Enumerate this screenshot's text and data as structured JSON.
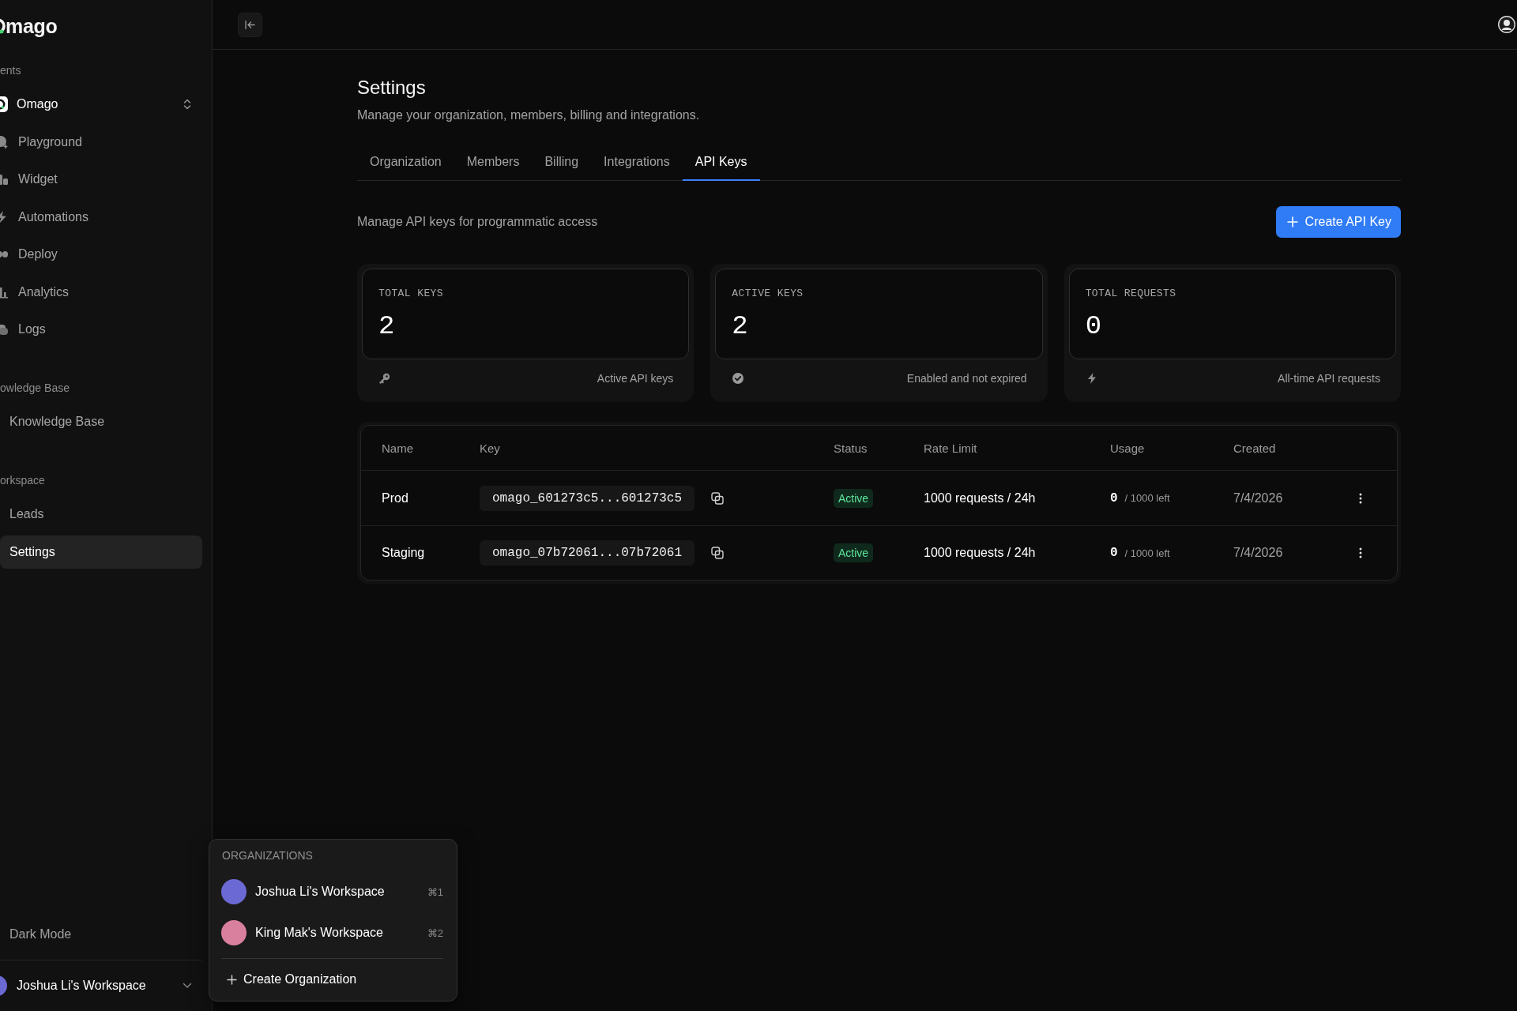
{
  "sidebar": {
    "logo": "mago",
    "groups": [
      {
        "label": "ents",
        "items": [
          {
            "kind": "selector",
            "label": "Omago",
            "selected": false
          },
          {
            "kind": "nav",
            "label": "Playground",
            "selected": false
          },
          {
            "kind": "nav",
            "label": "Widget",
            "selected": false
          },
          {
            "kind": "nav",
            "label": "Automations",
            "selected": false
          },
          {
            "kind": "nav",
            "label": "Deploy",
            "selected": false
          },
          {
            "kind": "nav",
            "label": "Analytics",
            "selected": false
          },
          {
            "kind": "nav",
            "label": "Logs",
            "selected": false
          }
        ]
      },
      {
        "label": "owledge Base",
        "items": [
          {
            "kind": "plain",
            "label": "Knowledge Base",
            "selected": false
          }
        ]
      },
      {
        "label": "orkspace",
        "items": [
          {
            "kind": "plain",
            "label": "Leads",
            "selected": false
          },
          {
            "kind": "plain",
            "label": "Settings",
            "selected": true
          }
        ]
      }
    ],
    "dark_mode": "Dark Mode",
    "workspace": "Joshua Li's Workspace"
  },
  "page": {
    "title": "Settings",
    "subtitle": "Manage your organization, members, billing and integrations.",
    "tabs": [
      {
        "label": "Organization",
        "selected": false
      },
      {
        "label": "Members",
        "selected": false
      },
      {
        "label": "Billing",
        "selected": false
      },
      {
        "label": "Integrations",
        "selected": false
      },
      {
        "label": "API Keys",
        "selected": true
      }
    ],
    "section_text": "Manage API keys for programmatic access",
    "create_button": "Create API Key",
    "stats": [
      {
        "label": "TOTAL KEYS",
        "value": "2",
        "caption": "Active API keys"
      },
      {
        "label": "ACTIVE KEYS",
        "value": "2",
        "caption": "Enabled and not expired"
      },
      {
        "label": "TOTAL REQUESTS",
        "value": "0",
        "caption": "All-time API requests"
      }
    ],
    "table": {
      "columns": [
        "Name",
        "Key",
        "Status",
        "Rate Limit",
        "Usage",
        "Created"
      ],
      "rows": [
        {
          "name": "Prod",
          "key": "omago_601273c5...601273c5",
          "status": "Active",
          "rate_limit": "1000 requests / 24h",
          "usage": "0",
          "usage_limit": "/ 1000 left",
          "created": "7/4/2026"
        },
        {
          "name": "Staging",
          "key": "omago_07b72061...07b72061",
          "status": "Active",
          "rate_limit": "1000 requests / 24h",
          "usage": "0",
          "usage_limit": "/ 1000 left",
          "created": "7/4/2026"
        }
      ]
    }
  },
  "org_menu": {
    "heading": "ORGANIZATIONS",
    "items": [
      {
        "name": "Joshua Li's Workspace",
        "shortcut": "⌘1",
        "color": "#6b69d3"
      },
      {
        "name": "King Mak's Workspace",
        "shortcut": "⌘2",
        "color": "#d9809f"
      }
    ],
    "create": "Create Organization"
  }
}
